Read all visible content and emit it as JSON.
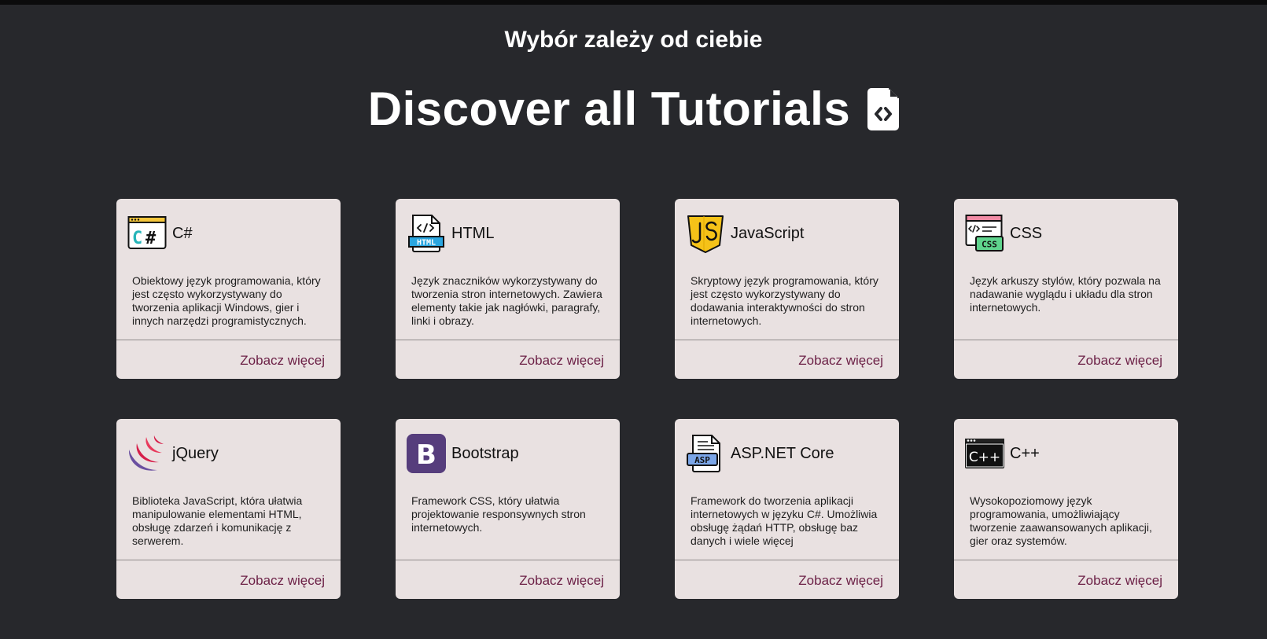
{
  "header": {
    "subtitle": "Wybór zależy od ciebie",
    "title": "Discover all Tutorials",
    "title_icon": "code-file-icon"
  },
  "colors": {
    "background": "#27282c",
    "card": "#e9e1e1",
    "link": "#6b1f45",
    "title": "#ffffff"
  },
  "cards": [
    {
      "title": "C#",
      "icon": "csharp-icon",
      "description": "Obiektowy język programowania, który jest często wykorzystywany do tworzenia aplikacji Windows, gier i innych narzędzi programistycznych.",
      "link": "Zobacz więcej"
    },
    {
      "title": "HTML",
      "icon": "html-file-icon",
      "description": "Język znaczników wykorzystywany do tworzenia stron internetowych. Zawiera elementy takie jak nagłówki, paragrafy, linki i obrazy.",
      "link": "Zobacz więcej"
    },
    {
      "title": "JavaScript",
      "icon": "javascript-shield-icon",
      "description": "Skryptowy język programowania, który jest często wykorzystywany do dodawania interaktywności do stron internetowych.",
      "link": "Zobacz więcej"
    },
    {
      "title": "CSS",
      "icon": "css-window-icon",
      "description": "Język arkuszy stylów, który pozwala na nadawanie wyglądu i układu dla stron internetowych.",
      "link": "Zobacz więcej"
    },
    {
      "title": "jQuery",
      "icon": "jquery-icon",
      "description": "Biblioteka JavaScript, która ułatwia manipulowanie elementami HTML, obsługę zdarzeń i komunikację z serwerem.",
      "link": "Zobacz więcej"
    },
    {
      "title": "Bootstrap",
      "icon": "bootstrap-icon",
      "description": "Framework CSS, który ułatwia projektowanie responsywnych stron internetowych.",
      "link": "Zobacz więcej"
    },
    {
      "title": "ASP.NET Core",
      "icon": "asp-file-icon",
      "description": "Framework do tworzenia aplikacji internetowych w języku C#. Umożliwia obsługę żądań HTTP, obsługę baz danych i wiele więcej",
      "link": "Zobacz więcej"
    },
    {
      "title": "C++",
      "icon": "cplusplus-window-icon",
      "description": "Wysokopoziomowy język programowania, umożliwiający tworzenie zaawansowanych aplikacji, gier oraz systemów.",
      "link": "Zobacz więcej"
    }
  ]
}
